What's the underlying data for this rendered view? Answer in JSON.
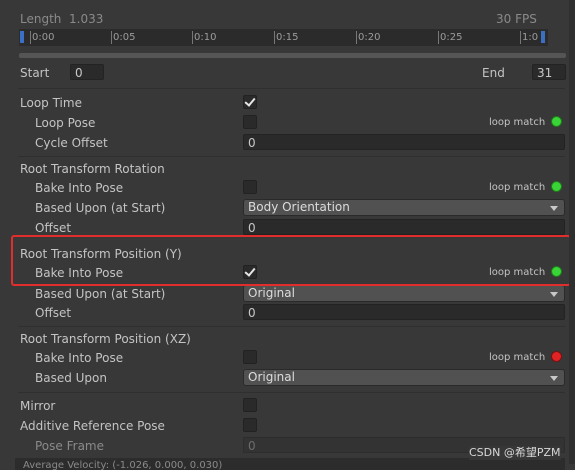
{
  "header": {
    "length_label": "Length",
    "length_value": "1.033",
    "fps": "30 FPS"
  },
  "timeline": {
    "ticks": [
      "0:00",
      "0:05",
      "0:10",
      "0:15",
      "0:20",
      "0:25",
      "1:0"
    ]
  },
  "range": {
    "start_label": "Start",
    "start_value": "0",
    "end_label": "End",
    "end_value": "31"
  },
  "loop": {
    "loop_time_label": "Loop Time",
    "loop_time_checked": true,
    "loop_pose_label": "Loop Pose",
    "loop_pose_checked": false,
    "loop_match": "loop match",
    "cycle_offset_label": "Cycle Offset",
    "cycle_offset_value": "0"
  },
  "root_rotation": {
    "title": "Root Transform Rotation",
    "bake_label": "Bake Into Pose",
    "bake_checked": false,
    "loop_match": "loop match",
    "loop_match_color": "#39d435",
    "based_upon_label": "Based Upon (at Start)",
    "based_upon_value": "Body Orientation",
    "offset_label": "Offset",
    "offset_value": "0"
  },
  "root_position_y": {
    "title": "Root Transform Position (Y)",
    "bake_label": "Bake Into Pose",
    "bake_checked": true,
    "loop_match": "loop match",
    "loop_match_color": "#39d435",
    "based_upon_label": "Based Upon (at Start)",
    "based_upon_value": "Original",
    "offset_label": "Offset",
    "offset_value": "0"
  },
  "root_position_xz": {
    "title": "Root Transform Position (XZ)",
    "bake_label": "Bake Into Pose",
    "bake_checked": false,
    "loop_match": "loop match",
    "loop_match_color": "#e22323",
    "based_upon_label": "Based Upon",
    "based_upon_value": "Original"
  },
  "misc": {
    "mirror_label": "Mirror",
    "mirror_checked": false,
    "additive_label": "Additive Reference Pose",
    "additive_checked": false,
    "pose_frame_label": "Pose Frame",
    "pose_frame_value": "0",
    "average_velocity": "Average Velocity: (-1.026, 0.000, 0.030)"
  },
  "watermark": "CSDN @希望PZM",
  "colors": {
    "highlight": "#e22d2d",
    "green": "#39d435",
    "red": "#e22323",
    "background": "#383838"
  },
  "icons": {
    "checkbox_check": "check-icon",
    "dropdown_arrow": "chevron-down-icon"
  }
}
